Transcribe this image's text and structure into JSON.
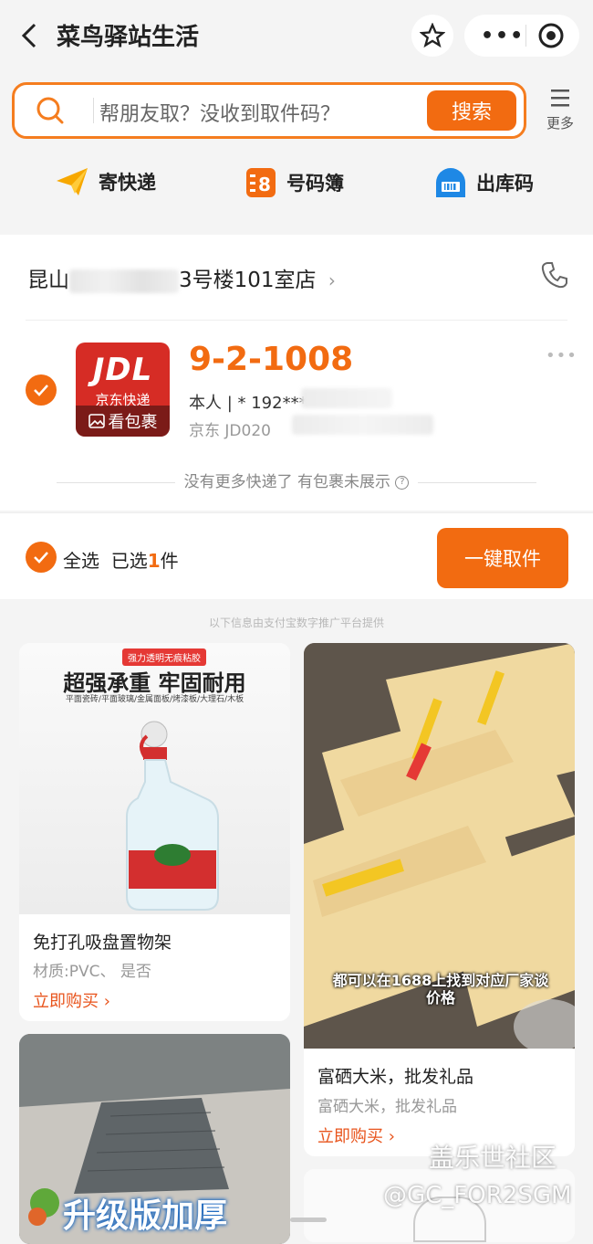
{
  "header": {
    "title": "菜鸟驿站生活"
  },
  "search": {
    "placeholder": "帮朋友取？没收到取件码？",
    "button": "搜索"
  },
  "more": {
    "label": "更多"
  },
  "quick_actions": [
    {
      "label": "寄快递",
      "icon": "send-icon"
    },
    {
      "label": "号码簿",
      "icon": "addressbook-icon"
    },
    {
      "label": "出库码",
      "icon": "barcode-icon"
    }
  ],
  "station": {
    "name_prefix": "昆山",
    "name_suffix": "3号楼101室店"
  },
  "parcel": {
    "logo": "JDL",
    "logo_sub": "京东快递",
    "view_label": "看包裹",
    "pickup_code": "9-2-1008",
    "owner": "本人 | *  192****",
    "tracking": "京东 JD020"
  },
  "no_more": "没有更多快递了  有包裹未展示",
  "select_bar": {
    "all": "全选",
    "selected_prefix": "已选",
    "count": "1",
    "unit": "件",
    "button": "一键取件"
  },
  "ad_note": "以下信息由支付宝数字推广平台提供",
  "products": [
    {
      "headline": "超强承重 牢固耐用",
      "tag": "强力透明无痕粘胶",
      "sub": "平面瓷砖/平面玻璃/金属面板/烤漆板/大理石/木板",
      "name": "免打孔吸盘置物架",
      "desc": "材质:PVC、 是否",
      "buy": "立即购买"
    },
    {
      "caption": "都可以在1688上找到对应厂家谈价格",
      "name": "富硒大米，批发礼品",
      "desc": "富硒大米，批发礼品",
      "buy": "立即购买"
    },
    {
      "headline": "升级版加厚"
    }
  ],
  "watermark": {
    "line1": "盖乐世社区",
    "line2": "@GC_FOR2SGM"
  },
  "colors": {
    "accent": "#f26b11",
    "jd_red": "#d62c25"
  }
}
